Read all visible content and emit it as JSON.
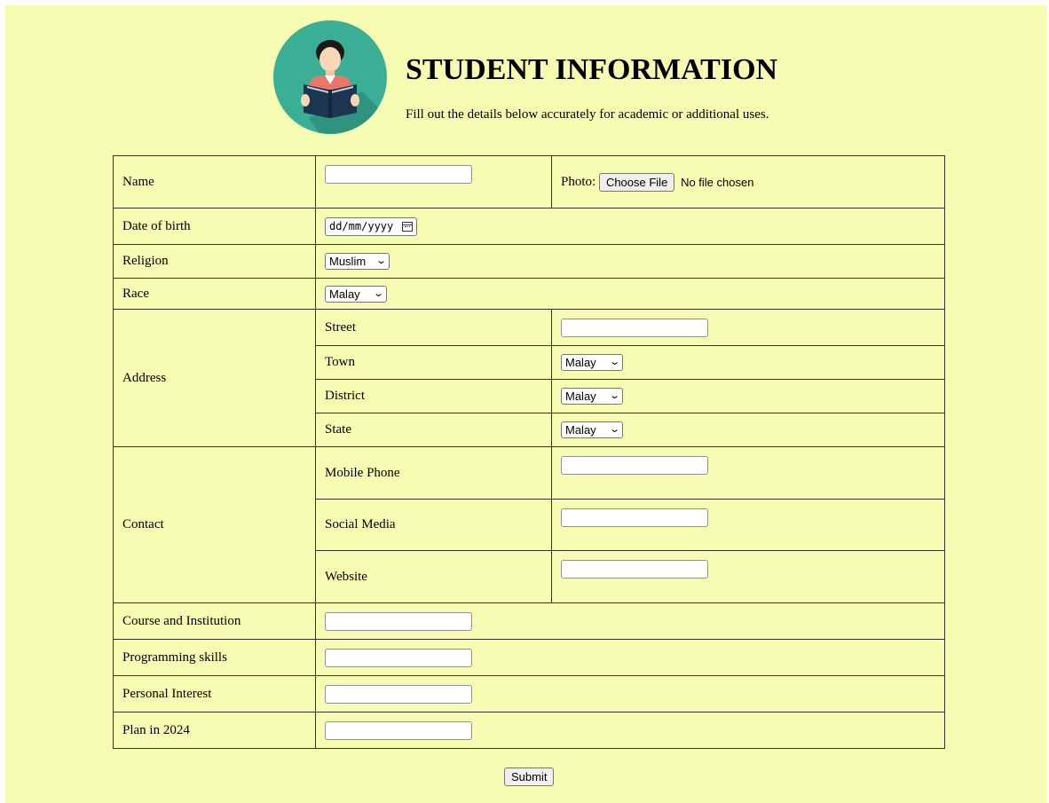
{
  "header": {
    "title": "STUDENT INFORMATION",
    "subtitle": "Fill out the details below accurately for academic or additional uses.",
    "logo_icon": "student-reading-book-icon"
  },
  "colors": {
    "background": "#f6fdb2",
    "logo_circle": "#3aaf96",
    "book": "#1c3550"
  },
  "rows": {
    "name": {
      "label": "Name",
      "value": ""
    },
    "photo": {
      "label": "Photo:",
      "button": "Choose File",
      "status": "No file chosen"
    },
    "dob": {
      "label": "Date of birth",
      "placeholder": "dd/mm/yyyy"
    },
    "religion": {
      "label": "Religion",
      "selected": "Muslim"
    },
    "race": {
      "label": "Race",
      "selected": "Malay"
    },
    "address": {
      "label": "Address",
      "street": {
        "label": "Street",
        "value": ""
      },
      "town": {
        "label": "Town",
        "selected": "Malay"
      },
      "district": {
        "label": "District",
        "selected": "Malay"
      },
      "state": {
        "label": "State",
        "selected": "Malay"
      }
    },
    "contact": {
      "label": "Contact",
      "mobile": {
        "label": "Mobile Phone",
        "value": ""
      },
      "social": {
        "label": "Social Media",
        "value": ""
      },
      "website": {
        "label": "Website",
        "value": ""
      }
    },
    "course": {
      "label": "Course and Institution",
      "value": ""
    },
    "programming": {
      "label": "Programming skills",
      "value": ""
    },
    "interest": {
      "label": "Personal Interest",
      "value": ""
    },
    "plan": {
      "label": "Plan in 2024",
      "value": ""
    }
  },
  "submit_label": "Submit"
}
